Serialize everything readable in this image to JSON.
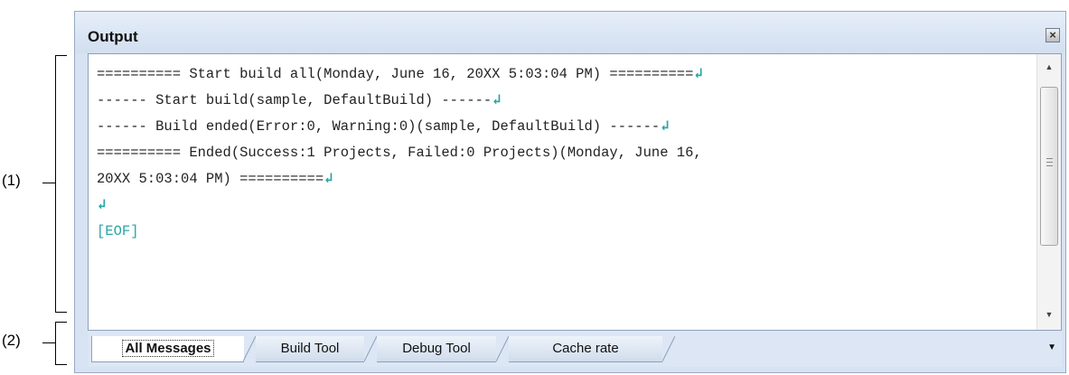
{
  "callouts": {
    "one": "(1)",
    "two": "(2)"
  },
  "panel": {
    "title": "Output",
    "close_label": "×"
  },
  "output_lines": [
    "========== Start build all(Monday, June 16, 20XX 5:03:04 PM) ==========",
    "------ Start build(sample, DefaultBuild) ------",
    "------ Build ended(Error:0, Warning:0)(sample, DefaultBuild) ------",
    "========== Ended(Success:1 Projects, Failed:0 Projects)(Monday, June 16,",
    "20XX 5:03:04 PM) ==========",
    "",
    "[EOF]"
  ],
  "tabs": [
    "All Messages",
    "Build Tool",
    "Debug Tool",
    "Cache rate"
  ],
  "icons": {
    "return_mark": "↲",
    "scroll_up": "▲",
    "scroll_down": "▼",
    "tab_menu": "▼"
  },
  "colors": {
    "accent": "#2aa5a5"
  }
}
